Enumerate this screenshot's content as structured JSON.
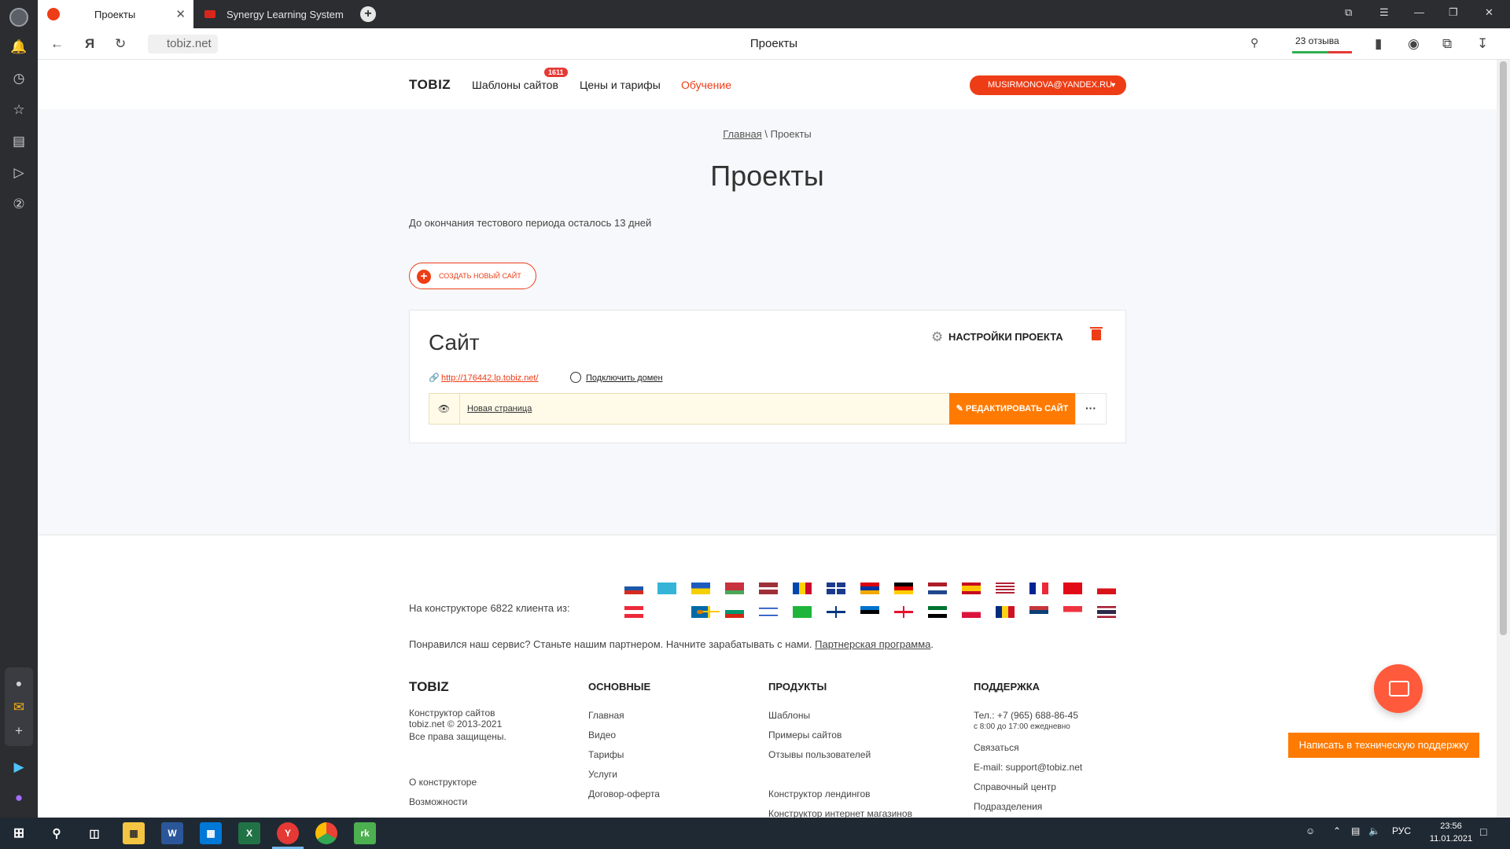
{
  "browser": {
    "tabs": [
      {
        "label": "Проекты",
        "active": true,
        "favicon_color": "#ee3d16"
      },
      {
        "label": "Synergy Learning System",
        "active": false,
        "favicon_color": "#d9261c"
      }
    ],
    "url": "tobiz.net",
    "page_title": "Проекты",
    "reviews_label": "23 отзыва"
  },
  "site": {
    "logo": "TOBIZ",
    "nav": {
      "templates": "Шаблоны сайтов",
      "templates_badge": "1611",
      "pricing": "Цены и тарифы",
      "learning": "Обучение"
    },
    "user_email": "MUSIRMONOVA@YANDEX.RU",
    "breadcrumb": {
      "home": "Главная",
      "separator": "\\",
      "current": "Проекты"
    },
    "heading": "Проекты",
    "trial_notice": "До окончания тестового периода осталось 13 дней",
    "create_button": "СОЗДАТЬ НОВЫЙ САЙТ",
    "project": {
      "title": "Сайт",
      "settings_label": "НАСТРОЙКИ ПРОЕКТА",
      "site_url": "http://176442.lp.tobiz.net/",
      "connect_domain": "Подключить домен",
      "page_name": "Новая страница",
      "edit_button": "РЕДАКТИРОВАТЬ САЙТ",
      "more_button": "···"
    },
    "footer": {
      "clients_text": "На конструкторе 6822 клиента из:",
      "partner_text": "Понравился наш сервис? Станьте нашим партнером. Начните зарабатывать с нами.",
      "partner_link": "Партнерская программа",
      "logo": "TOBIZ",
      "about_lines": [
        "Конструктор сайтов",
        "tobiz.net © 2013-2021",
        "Все права защищены."
      ],
      "about_links": [
        "О конструкторе",
        "Возможности"
      ],
      "col_main_title": "ОСНОВНЫЕ",
      "col_main": [
        "Главная",
        "Видео",
        "Тарифы",
        "Услуги",
        "Договор-оферта"
      ],
      "col_products_title": "ПРОДУКТЫ",
      "col_products": [
        "Шаблоны",
        "Примеры сайтов",
        "Отзывы пользователей"
      ],
      "col_products_more": [
        "Конструктор лендингов",
        "Конструктор интернет магазинов"
      ],
      "col_support_title": "ПОДДЕРЖКА",
      "phone": "Тел.: +7 (965) 688-86-45",
      "hours": "с 8:00 до 17:00 ежедневно",
      "contact": "Связаться",
      "email": "E-mail: support@tobiz.net",
      "help_center": "Справочный центр",
      "divisions": "Подразделения"
    },
    "support_button": "Написать в техническую поддержку"
  },
  "taskbar": {
    "language": "РУС",
    "time": "23:56",
    "date": "11.01.2021",
    "apps": [
      "file-explorer",
      "word",
      "store",
      "excel",
      "yandex-browser",
      "chrome",
      "rk-app"
    ]
  },
  "colors": {
    "brand": "#ee3d16",
    "edit": "#ff7a00",
    "background": "#f7f8fb"
  }
}
